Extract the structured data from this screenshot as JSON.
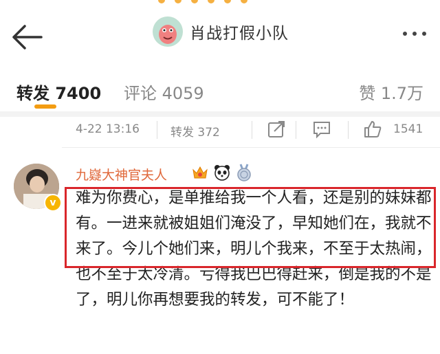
{
  "header": {
    "title": "肖战打假小队",
    "back_icon": "back-arrow-icon",
    "more_icon": "more-dots-icon"
  },
  "tabs": [
    {
      "label": "转发 7400"
    },
    {
      "label": "评论 4059"
    },
    {
      "label": "赞 1.7万"
    }
  ],
  "meta": {
    "time": "4-22 13:16",
    "forward": "转发 372",
    "likes": "1541"
  },
  "comment": {
    "username": "九嶷大神官夫人",
    "text": "难为你费心，是单推给我一个人看，还是别的妹妹都有。一进来就被姐姐们淹没了，早知她们在，我就不来了。今儿个她们来，明儿个我来，不至于太热闹，也不至于太冷清。亏得我巴巴得赶来，倒是我的不是了，明儿你再想要我的转发，可不能了！"
  },
  "colors": {
    "accent": "#f39c12",
    "username": "#e0683a",
    "highlight": "#d9262b"
  }
}
